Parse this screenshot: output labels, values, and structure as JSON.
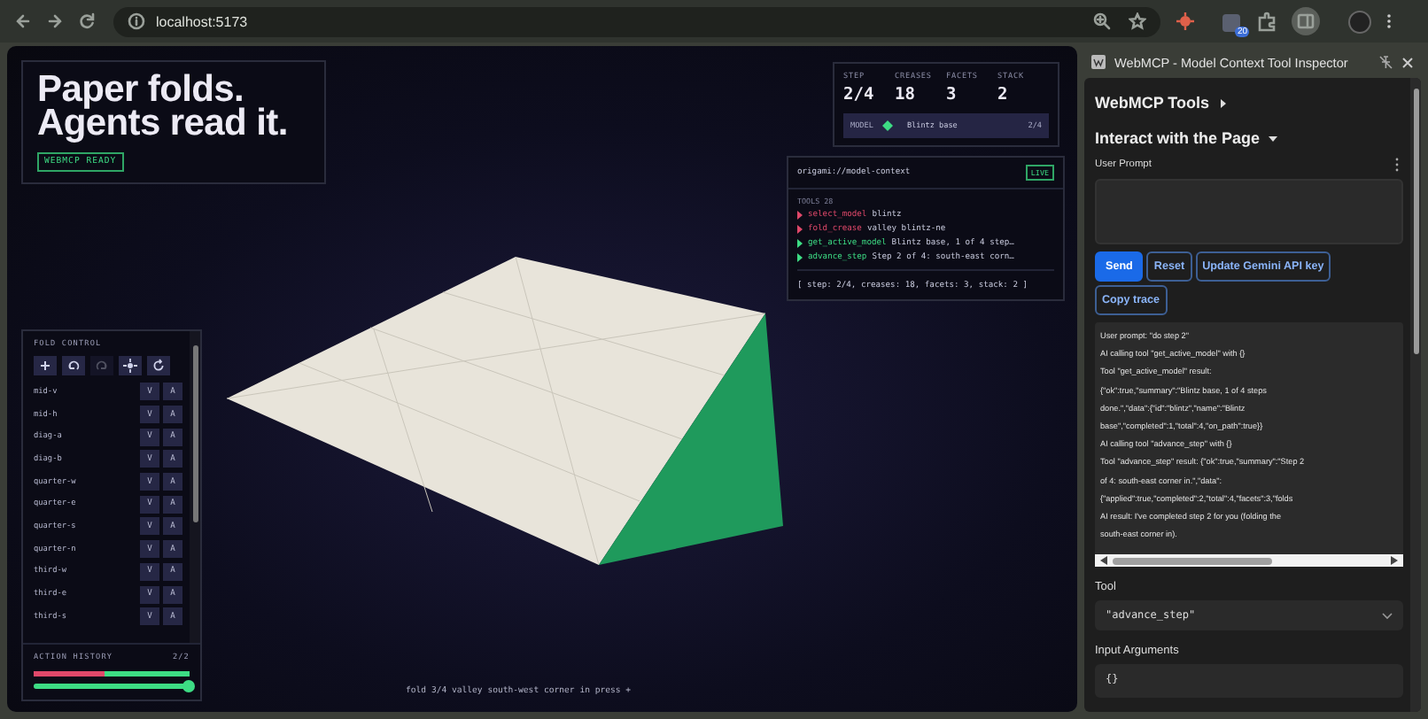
{
  "browser": {
    "url": "localhost:5173",
    "badge": "20"
  },
  "hero": {
    "title_lines": [
      "Paper folds.",
      "Agents read it."
    ],
    "badge": "WEBMCP READY"
  },
  "stats": [
    {
      "label": "STEP",
      "value": "2/4"
    },
    {
      "label": "CREASES",
      "value": "18"
    },
    {
      "label": "FACETS",
      "value": "3"
    },
    {
      "label": "STACK",
      "value": "2"
    }
  ],
  "model": {
    "label": "MODEL",
    "name": "Blintz base",
    "progress": "2/4"
  },
  "context": {
    "uri": "origami://model-context",
    "badge": "LIVE",
    "tools_label": "TOOLS 28",
    "calls": [
      {
        "name": "select_model",
        "args": "blintz",
        "color": "#e0486a"
      },
      {
        "name": "fold_crease",
        "args": "valley blintz-ne",
        "color": "#e0486a"
      },
      {
        "name": "get_active_model",
        "args": "Blintz base, 1 of 4 step…",
        "color": "#3ddc84"
      },
      {
        "name": "advance_step",
        "args": "Step 2 of 4: south-east corn…",
        "color": "#3ddc84"
      }
    ],
    "summary": "[ step: 2/4, creases: 18, facets: 3, stack: 2 ]"
  },
  "fold_control": {
    "title": "FOLD CONTROL",
    "tools": [
      {
        "kind": "add",
        "disabled": false
      },
      {
        "kind": "undo",
        "disabled": false
      },
      {
        "kind": "redo",
        "disabled": true
      },
      {
        "kind": "target",
        "disabled": false
      },
      {
        "kind": "rotate",
        "disabled": false
      }
    ],
    "creases": [
      {
        "name": "mid-v",
        "valley": "V",
        "mountain": "A"
      },
      {
        "name": "mid-h",
        "valley": "V",
        "mountain": "A"
      },
      {
        "name": "diag-a",
        "valley": "V",
        "mountain": "A"
      },
      {
        "name": "diag-b",
        "valley": "V",
        "mountain": "A"
      },
      {
        "name": "quarter-w",
        "valley": "V",
        "mountain": "A"
      },
      {
        "name": "quarter-e",
        "valley": "V",
        "mountain": "A"
      },
      {
        "name": "quarter-s",
        "valley": "V",
        "mountain": "A"
      },
      {
        "name": "quarter-n",
        "valley": "V",
        "mountain": "A"
      },
      {
        "name": "third-w",
        "valley": "V",
        "mountain": "A"
      },
      {
        "name": "third-e",
        "valley": "V",
        "mountain": "A"
      },
      {
        "name": "third-s",
        "valley": "V",
        "mountain": "A"
      }
    ]
  },
  "history": {
    "label": "ACTION HISTORY",
    "count": "2/2",
    "bar": {
      "level": 0.45
    },
    "slider": {
      "level": 1
    }
  },
  "caption": "fold 3/4 valley south-west corner in press +",
  "devtools": {
    "title": "WebMCP - Model Context Tool Inspector",
    "sections": [
      {
        "label": "WebMCP Tools",
        "expanded": false
      },
      {
        "label": "Interact with the Page",
        "expanded": true
      }
    ],
    "prompt_label": "User Prompt",
    "buttons": [
      {
        "label": "Send",
        "primary": true
      },
      {
        "label": "Reset",
        "primary": false
      },
      {
        "label": "Update Gemini API key",
        "primary": false
      },
      {
        "label": "Copy trace",
        "primary": false
      }
    ],
    "log": [
      "User prompt: \"do step 2\"",
      "AI calling tool \"get_active_model\" with {}",
      "Tool \"get_active_model\" result:",
      "{\"ok\":true,\"summary\":\"Blintz base, 1 of 4 steps",
      "done.\",\"data\":{\"id\":\"blintz\",\"name\":\"Blintz",
      "base\",\"completed\":1,\"total\":4,\"on_path\":true}}",
      "AI calling tool \"advance_step\" with {}",
      "Tool \"advance_step\" result: {\"ok\":true,\"summary\":\"Step 2",
      "of 4: south-east corner in.\",\"data\":",
      "{\"applied\":true,\"completed\":2,\"total\":4,\"facets\":3,\"folds",
      "AI result: I've completed step 2 for you (folding the",
      "south-east corner in)."
    ],
    "tool_label": "Tool",
    "tool_value": "\"advance_step\"",
    "args_label": "Input Arguments",
    "args_value": "{}"
  }
}
